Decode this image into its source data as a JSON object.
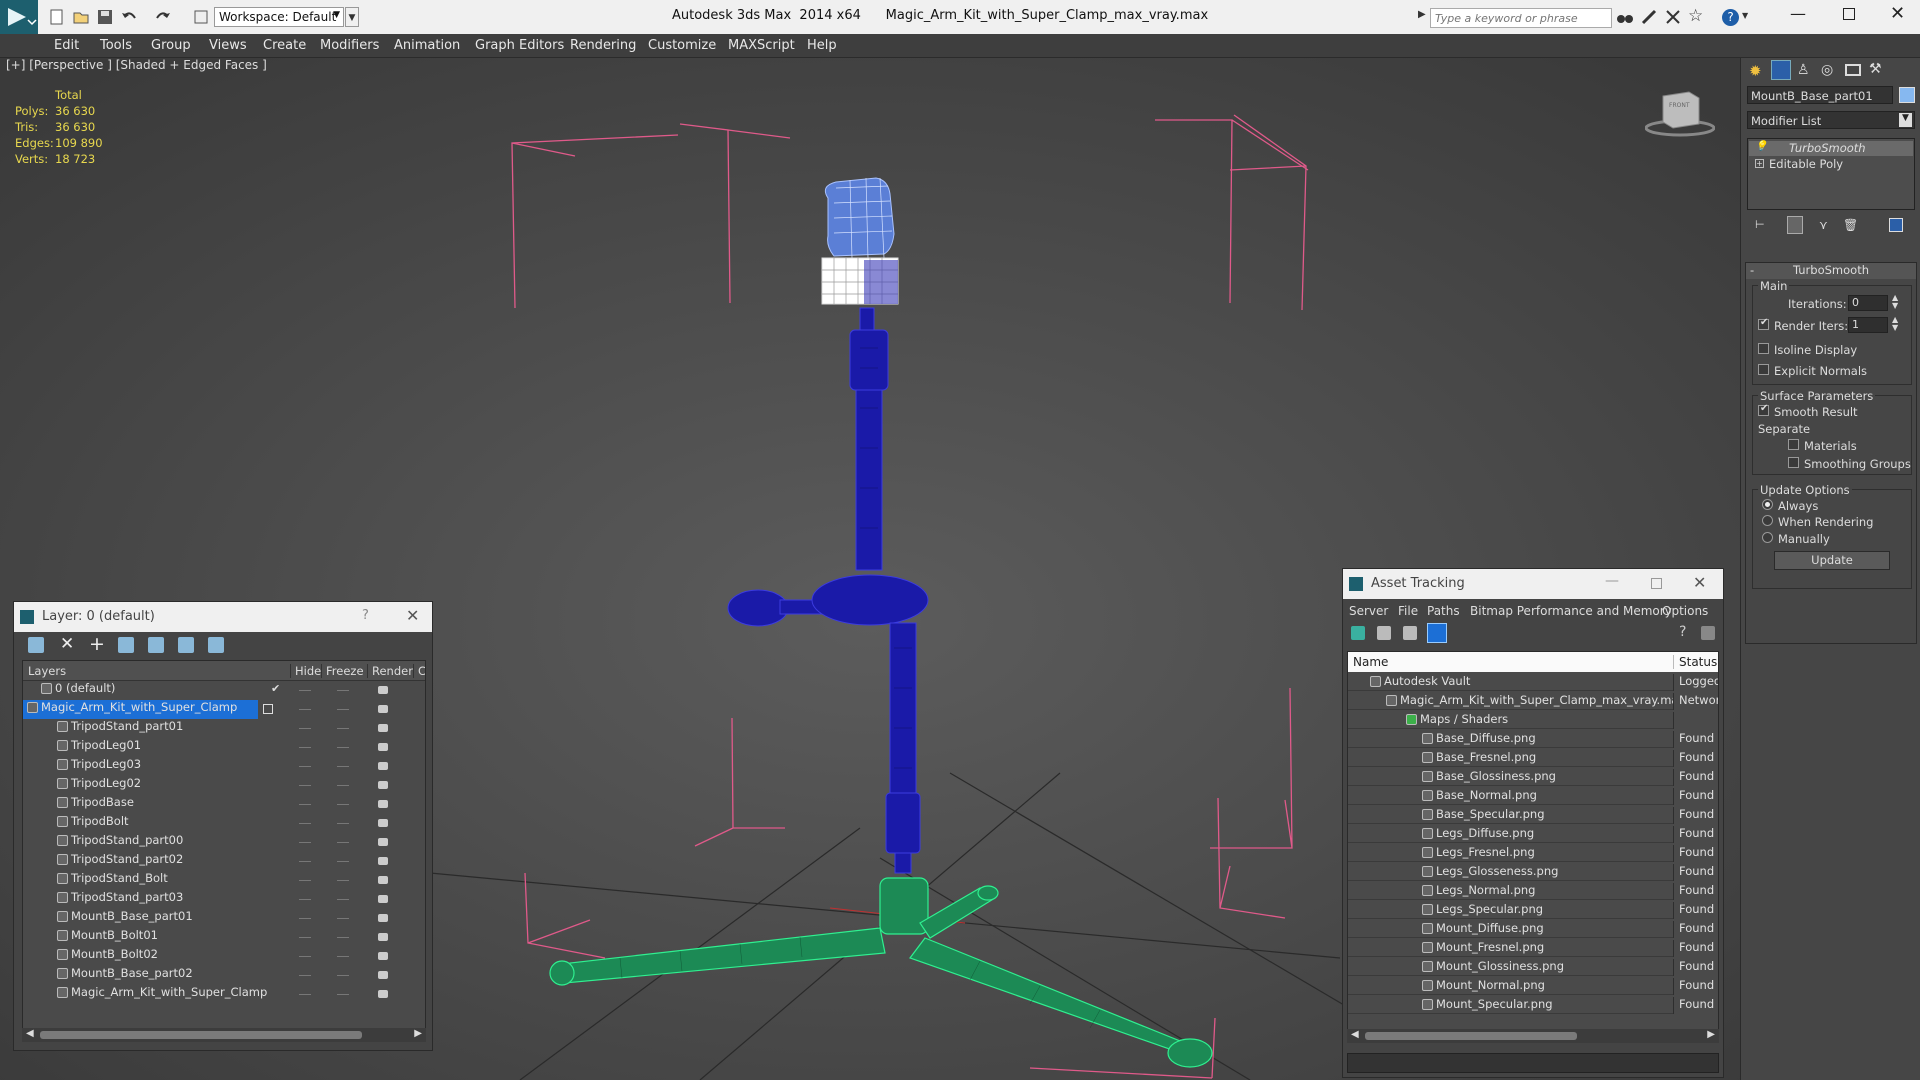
{
  "titlebar": {
    "workspace": "Workspace: Default",
    "title": "Autodesk 3ds Max  2014 x64      Magic_Arm_Kit_with_Super_Clamp_max_vray.max",
    "search_placeholder": "Type a keyword or phrase"
  },
  "menu": [
    "Edit",
    "Tools",
    "Group",
    "Views",
    "Create",
    "Modifiers",
    "Animation",
    "Graph Editors",
    "Rendering",
    "Customize",
    "MAXScript",
    "Help"
  ],
  "viewport": {
    "label": "[+] [Perspective ] [Shaded + Edged Faces ]",
    "stats_header": "Total",
    "stats": [
      {
        "label": "Polys:",
        "value": "36 630"
      },
      {
        "label": "Tris:",
        "value": "36 630"
      },
      {
        "label": "Edges:",
        "value": "109 890"
      },
      {
        "label": "Verts:",
        "value": "18 723"
      }
    ],
    "viewcube_label": "FRONT"
  },
  "layer_window": {
    "title": "Layer: 0 (default)",
    "help": "?",
    "columns": [
      "Layers",
      "Hide",
      "Freeze",
      "Render",
      "C"
    ],
    "rows": [
      {
        "name": "0 (default)",
        "level": 1,
        "selected": false
      },
      {
        "name": "Magic_Arm_Kit_with_Super_Clamp",
        "level": 0,
        "selected": true
      },
      {
        "name": "TripodStand_part01",
        "level": 2,
        "selected": false
      },
      {
        "name": "TripodLeg01",
        "level": 2,
        "selected": false
      },
      {
        "name": "TripodLeg03",
        "level": 2,
        "selected": false
      },
      {
        "name": "TripodLeg02",
        "level": 2,
        "selected": false
      },
      {
        "name": "TripodBase",
        "level": 2,
        "selected": false
      },
      {
        "name": "TripodBolt",
        "level": 2,
        "selected": false
      },
      {
        "name": "TripodStand_part00",
        "level": 2,
        "selected": false
      },
      {
        "name": "TripodStand_part02",
        "level": 2,
        "selected": false
      },
      {
        "name": "TripodStand_Bolt",
        "level": 2,
        "selected": false
      },
      {
        "name": "TripodStand_part03",
        "level": 2,
        "selected": false
      },
      {
        "name": "MountB_Base_part01",
        "level": 2,
        "selected": false
      },
      {
        "name": "MountB_Bolt01",
        "level": 2,
        "selected": false
      },
      {
        "name": "MountB_Bolt02",
        "level": 2,
        "selected": false
      },
      {
        "name": "MountB_Base_part02",
        "level": 2,
        "selected": false
      },
      {
        "name": "Magic_Arm_Kit_with_Super_Clamp",
        "level": 2,
        "selected": false
      }
    ]
  },
  "asset_window": {
    "title": "Asset Tracking",
    "menu": [
      "Server",
      "File",
      "Paths",
      "Bitmap Performance and Memory",
      "Options"
    ],
    "columns": [
      "Name",
      "Status"
    ],
    "rows": [
      {
        "name": "Autodesk Vault",
        "status": "Logged",
        "level": 0
      },
      {
        "name": "Magic_Arm_Kit_with_Super_Clamp_max_vray.max",
        "status": "Networ",
        "level": 1
      },
      {
        "name": "Maps / Shaders",
        "status": "",
        "level": 2
      },
      {
        "name": "Base_Diffuse.png",
        "status": "Found",
        "level": 3
      },
      {
        "name": "Base_Fresnel.png",
        "status": "Found",
        "level": 3
      },
      {
        "name": "Base_Glossiness.png",
        "status": "Found",
        "level": 3
      },
      {
        "name": "Base_Normal.png",
        "status": "Found",
        "level": 3
      },
      {
        "name": "Base_Specular.png",
        "status": "Found",
        "level": 3
      },
      {
        "name": "Legs_Diffuse.png",
        "status": "Found",
        "level": 3
      },
      {
        "name": "Legs_Fresnel.png",
        "status": "Found",
        "level": 3
      },
      {
        "name": "Legs_Glosseness.png",
        "status": "Found",
        "level": 3
      },
      {
        "name": "Legs_Normal.png",
        "status": "Found",
        "level": 3
      },
      {
        "name": "Legs_Specular.png",
        "status": "Found",
        "level": 3
      },
      {
        "name": "Mount_Diffuse.png",
        "status": "Found",
        "level": 3
      },
      {
        "name": "Mount_Fresnel.png",
        "status": "Found",
        "level": 3
      },
      {
        "name": "Mount_Glossiness.png",
        "status": "Found",
        "level": 3
      },
      {
        "name": "Mount_Normal.png",
        "status": "Found",
        "level": 3
      },
      {
        "name": "Mount_Specular.png",
        "status": "Found",
        "level": 3
      }
    ]
  },
  "command_panel": {
    "object_name": "MountB_Base_part01",
    "modifier_list": "Modifier List",
    "stack": [
      "TurboSmooth",
      "Editable Poly"
    ],
    "rollout_title": "TurboSmooth",
    "main_label": "Main",
    "iterations_label": "Iterations:",
    "iterations_value": "0",
    "render_iters_label": "Render Iters:",
    "render_iters_value": "1",
    "isoline": "Isoline Display",
    "explicit_normals": "Explicit Normals",
    "surface_params": "Surface Parameters",
    "smooth_result": "Smooth Result",
    "separate": "Separate",
    "materials": "Materials",
    "smoothing_groups": "Smoothing Groups",
    "update_options": "Update Options",
    "always": "Always",
    "when_rendering": "When Rendering",
    "manually": "Manually",
    "update_button": "Update"
  },
  "colors": {
    "accent": "#1c6fd6",
    "wire_blue": "#1a1aa8",
    "wire_green": "#22d47a",
    "bbox_pink": "#e05a8a",
    "stats_yellow": "#e8d84e"
  }
}
